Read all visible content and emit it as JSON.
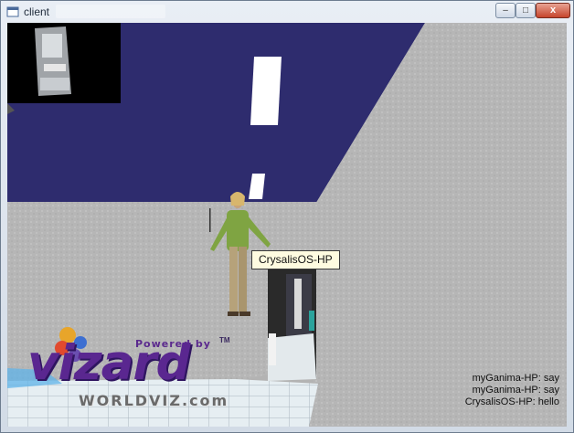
{
  "window": {
    "title": "client",
    "buttons": {
      "minimize": "–",
      "maximize": "□",
      "close": "x"
    }
  },
  "scene": {
    "avatar_tag": "CrysalisOS-HP",
    "chat": [
      "myGanima-HP: say",
      "myGanima-HP: say",
      "CrysalisOS-HP: hello"
    ]
  },
  "logo": {
    "powered_by": "Powered by",
    "trademark": "TM",
    "name": "vizard",
    "site": "WORLDVIZ.com"
  },
  "colors": {
    "ceiling": "#2e2c6e",
    "wall": "#b4b4b4",
    "brand": "#5a2790"
  },
  "icons": {
    "app": "window-app-icon"
  }
}
